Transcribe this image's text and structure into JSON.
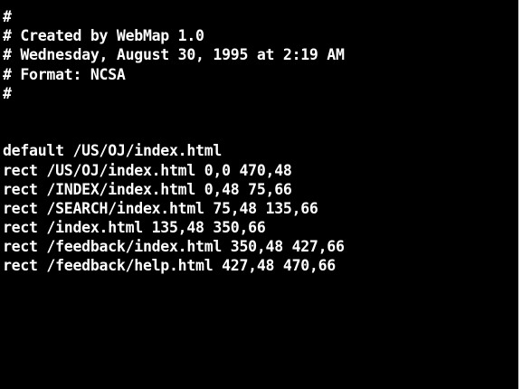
{
  "file": {
    "lines": [
      "#",
      "# Created by WebMap 1.0",
      "# Wednesday, August 30, 1995 at 2:19 AM",
      "# Format: NCSA",
      "#",
      "",
      "",
      "default /US/OJ/index.html",
      "rect /US/OJ/index.html 0,0 470,48",
      "rect /INDEX/index.html 0,48 75,66",
      "rect /SEARCH/index.html 75,48 135,66",
      "rect /index.html 135,48 350,66",
      "rect /feedback/index.html 350,48 427,66",
      "rect /feedback/help.html 427,48 470,66"
    ]
  },
  "colors": {
    "background": "#000000",
    "text": "#ffffff"
  }
}
